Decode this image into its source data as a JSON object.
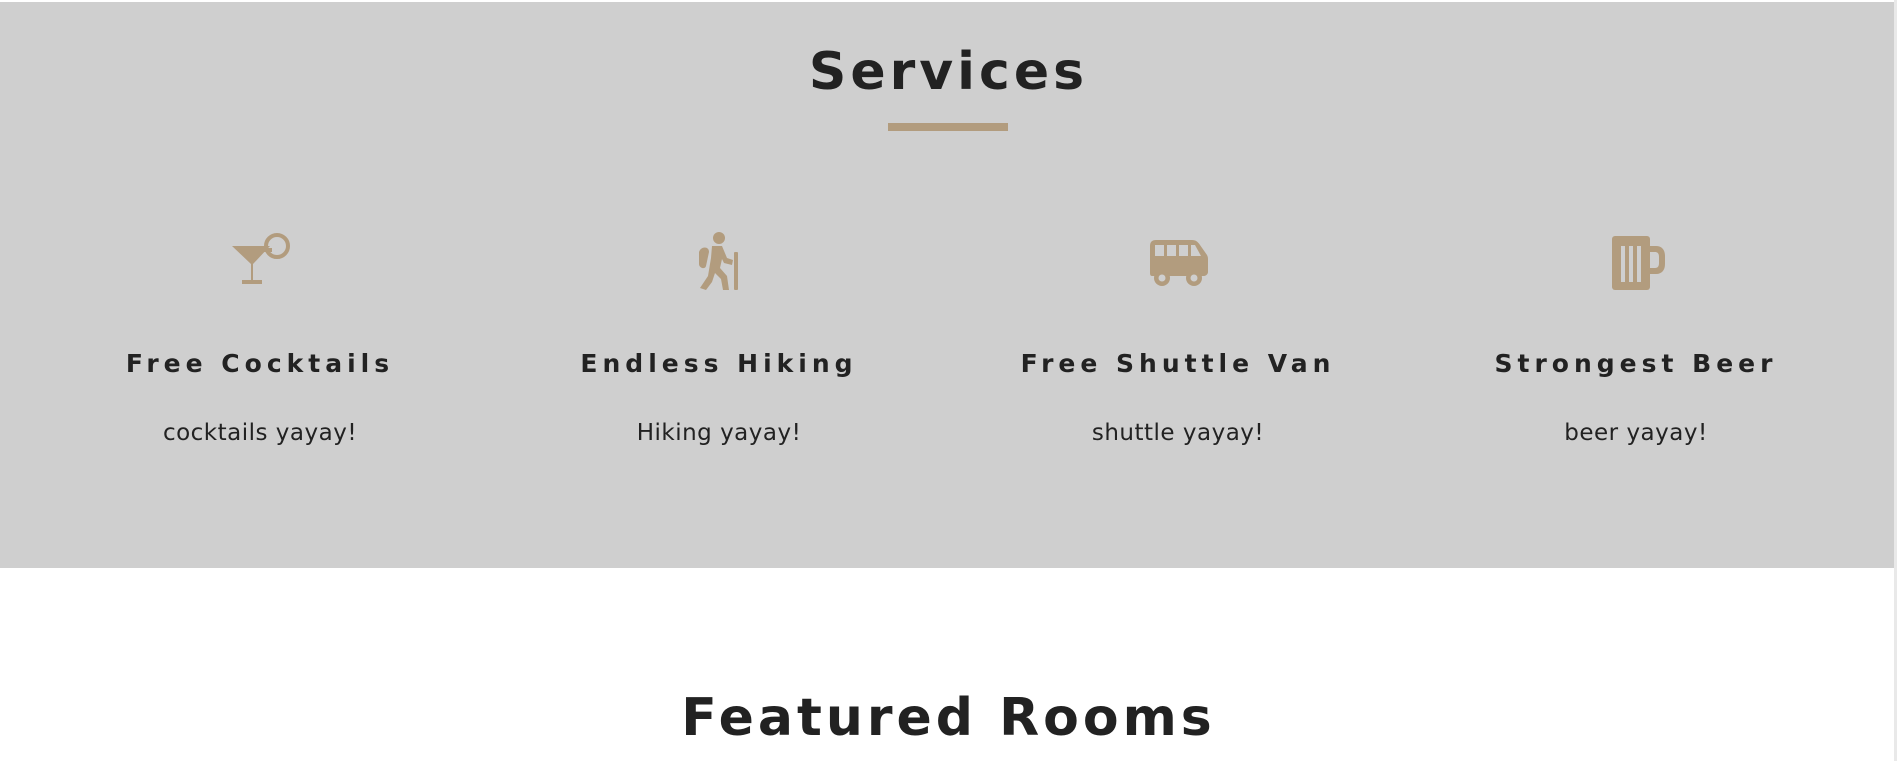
{
  "services": {
    "title": "Services",
    "accent_color": "#b29c7e",
    "background_color": "#cfcfcf",
    "items": [
      {
        "icon": "cocktail-icon",
        "name": "Free Cocktails",
        "description": "cocktails yayay!"
      },
      {
        "icon": "hiking-icon",
        "name": "Endless Hiking",
        "description": "Hiking yayay!"
      },
      {
        "icon": "shuttle-van-icon",
        "name": "Free Shuttle Van",
        "description": "shuttle yayay!"
      },
      {
        "icon": "beer-icon",
        "name": "Strongest Beer",
        "description": "beer yayay!"
      }
    ]
  },
  "featured": {
    "title": "Featured Rooms"
  }
}
